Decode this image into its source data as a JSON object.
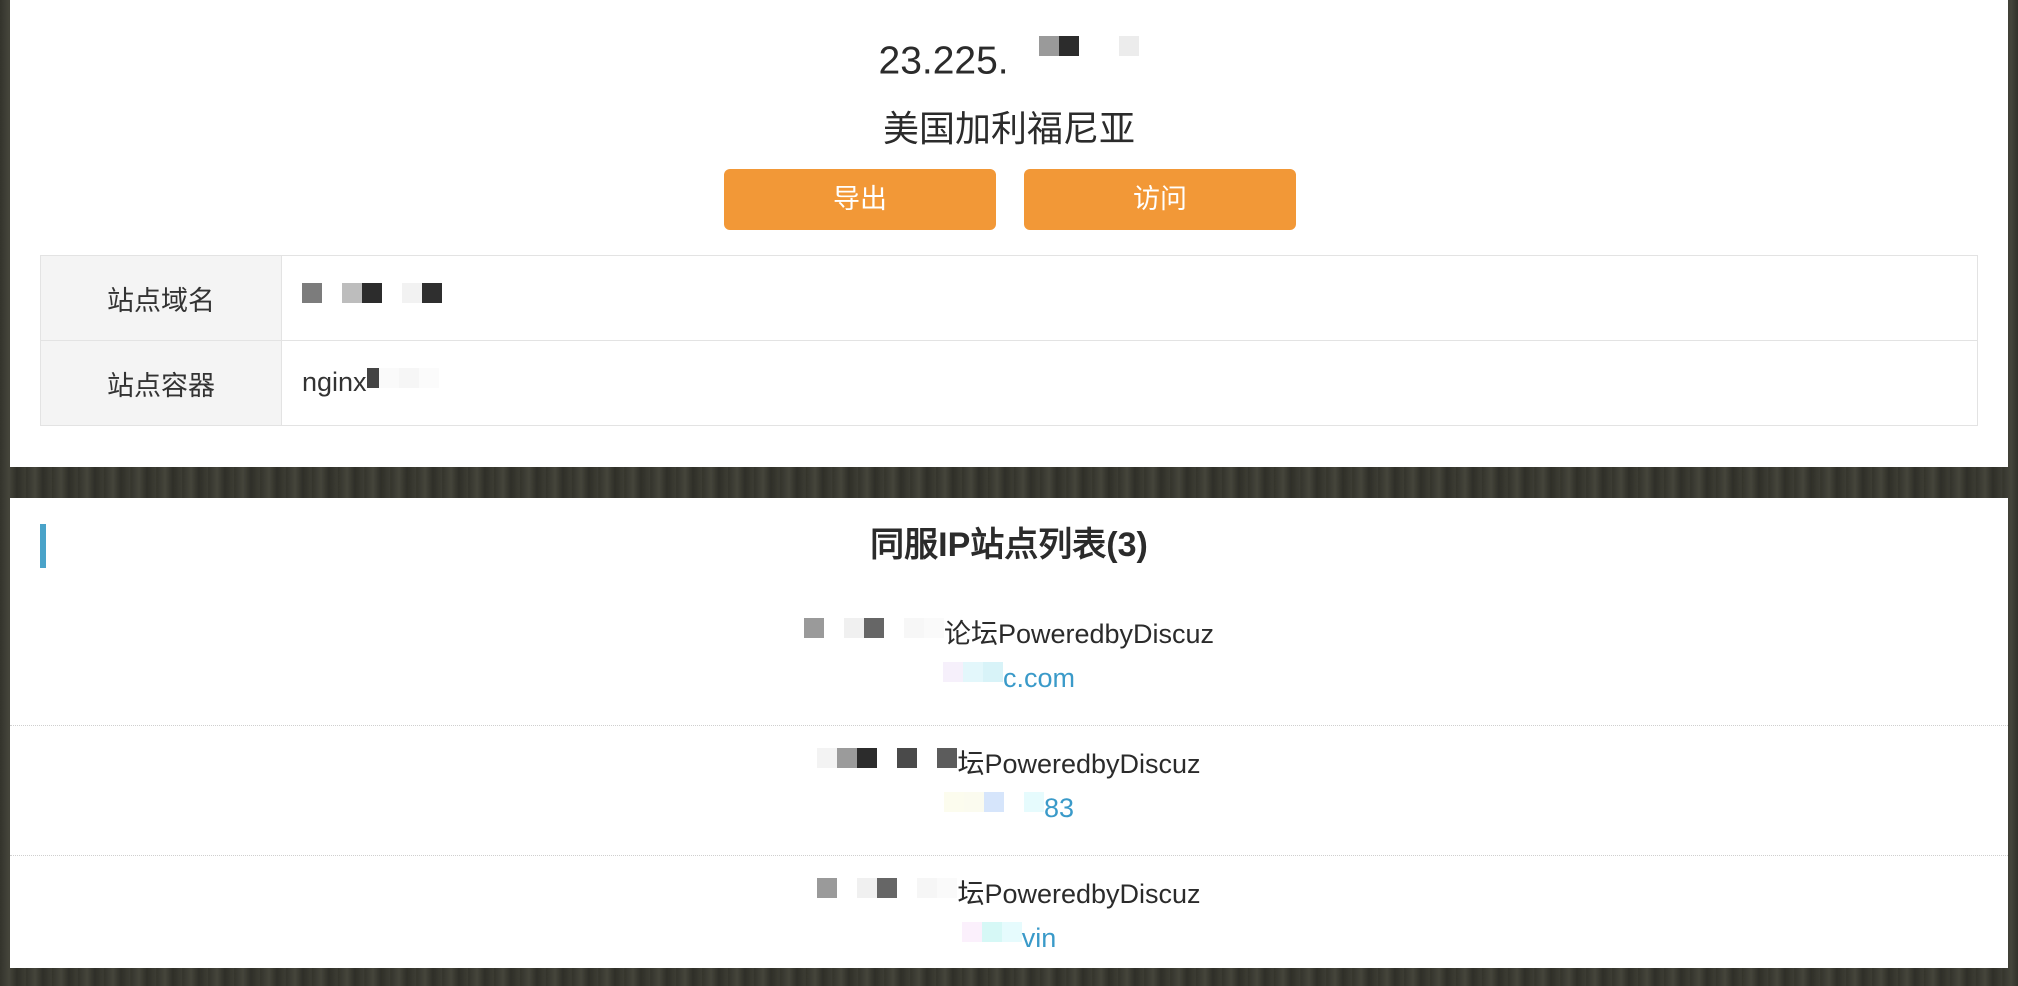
{
  "ip": {
    "prefix": "23.225."
  },
  "location": "美国加利福尼亚",
  "buttons": {
    "export": "导出",
    "visit": "访问"
  },
  "info": {
    "domain_label": "站点域名",
    "container_label": "站点容器",
    "container_value": "nginx"
  },
  "same_ip": {
    "title": "同服IP站点列表(3)",
    "sites": [
      {
        "title": "论坛PoweredbyDiscuz",
        "url": "c.com"
      },
      {
        "title": "坛PoweredbyDiscuz",
        "url": "83"
      },
      {
        "title": "坛PoweredbyDiscuz",
        "url": "vin"
      }
    ]
  },
  "colors": {
    "accent_orange": "#f29837",
    "link_blue": "#3a9ac9",
    "section_accent": "#4aa3c9"
  }
}
